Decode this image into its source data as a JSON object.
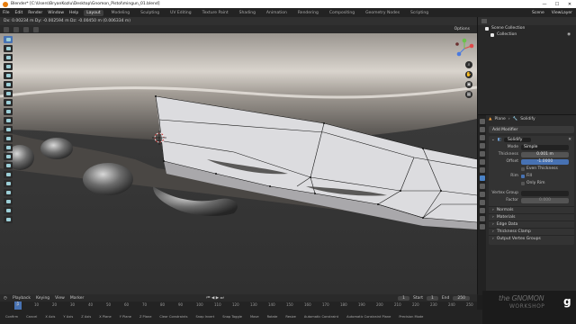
{
  "window": {
    "title": "Blender* [C:\\Users\\BryanKozlu\\Desktop\\Gnomon_Pistol\\mingun_01.blend]",
    "controls": [
      "—",
      "☐",
      "✕"
    ]
  },
  "menubar": {
    "menus": [
      "File",
      "Edit",
      "Render",
      "Window",
      "Help"
    ],
    "workspaces": [
      "Layout",
      "Modeling",
      "Sculpting",
      "UV Editing",
      "Texture Paint",
      "Shading",
      "Animation",
      "Rendering",
      "Compositing",
      "Geometry Nodes",
      "Scripting"
    ],
    "active_workspace": "Layout",
    "scene": "Scene",
    "view_layer": "ViewLayer"
  },
  "viewport_header": {
    "readout": "Dx: 0.00234 m   Dy: -0.002594 m   Dz: -0.00450 m   (0.006334 m)",
    "options": "Options"
  },
  "outliner": {
    "title": "Scene Collection",
    "collection": "Collection"
  },
  "properties": {
    "context": [
      "Plane",
      "Solidify"
    ],
    "add_modifier": "Add Modifier",
    "modifier_name": "Solidify",
    "fields": [
      {
        "label": "Mode",
        "value": "Simple",
        "style": "dark"
      },
      {
        "label": "Thickness",
        "value": "0.001 m",
        "style": "normal"
      },
      {
        "label": "Offset",
        "value": "-1.0000",
        "style": "blue"
      }
    ],
    "even_thickness": "Even Thickness",
    "rim_label": "Rim",
    "rim_fill": "Fill",
    "only_rim": "Only Rim",
    "vertex_group": "Vertex Group",
    "factor_label": "Factor",
    "factor_value": "0.000",
    "subpanels": [
      "Normals",
      "Materials",
      "Edge Data",
      "Thickness Clamp",
      "Output Vertex Groups"
    ]
  },
  "timeline": {
    "menus": [
      "Playback",
      "Keying",
      "View",
      "Marker"
    ],
    "current_frame": "1",
    "start_label": "Start",
    "start": "1",
    "end_label": "End",
    "end": "250",
    "ticks": [
      "0",
      "10",
      "20",
      "30",
      "40",
      "50",
      "60",
      "70",
      "80",
      "90",
      "100",
      "110",
      "120",
      "130",
      "140",
      "150",
      "160",
      "170",
      "180",
      "190",
      "200",
      "210",
      "220",
      "230",
      "240",
      "250"
    ]
  },
  "statusbar": [
    "Confirm",
    "Cancel",
    "X Axis",
    "Y Axis",
    "Z Axis",
    "X Plane",
    "Y Plane",
    "Z Plane",
    "Clear Constraints",
    "Snap Invert",
    "Snap Toggle",
    "Move",
    "Rotate",
    "Resize",
    "Automatic Constraint",
    "Automatic Constraint Plane",
    "Precision Mode"
  ],
  "watermark": {
    "line1": "the GNOMON",
    "line2": "WORKSHOP",
    "logo": "g"
  }
}
